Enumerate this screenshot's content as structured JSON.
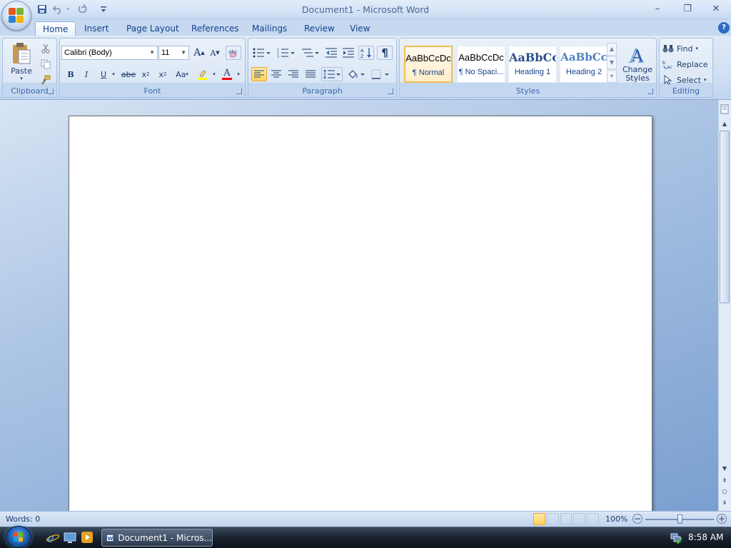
{
  "window": {
    "title": "Document1 - Microsoft Word"
  },
  "quick_access": {
    "save_icon": "save-icon",
    "undo_icon": "undo-icon",
    "redo_icon": "redo-icon",
    "customize_icon": "customize-icon"
  },
  "window_controls": {
    "minimize": "–",
    "restore": "❐",
    "close": "✕"
  },
  "tabs": [
    {
      "label": "Home"
    },
    {
      "label": "Insert"
    },
    {
      "label": "Page Layout"
    },
    {
      "label": "References"
    },
    {
      "label": "Mailings"
    },
    {
      "label": "Review"
    },
    {
      "label": "View"
    }
  ],
  "help": "?",
  "ribbon": {
    "clipboard": {
      "label": "Clipboard",
      "paste": "Paste"
    },
    "font": {
      "label": "Font",
      "family": "Calibri (Body)",
      "size": "11",
      "grow": "A",
      "shrink": "A",
      "bold": "B",
      "italic": "I",
      "underline": "U",
      "strike": "abe",
      "subscript": "x",
      "sub_mark": "2",
      "superscript": "x",
      "sup_mark": "2",
      "case": "Aa",
      "font_color": "A"
    },
    "paragraph": {
      "label": "Paragraph",
      "pilcrow": "¶"
    },
    "styles": {
      "label": "Styles",
      "items": [
        {
          "sample": "AaBbCcDc",
          "name": "¶ Normal"
        },
        {
          "sample": "AaBbCcDc",
          "name": "¶ No Spaci..."
        },
        {
          "sample": "AaBbCc",
          "name": "Heading 1"
        },
        {
          "sample": "AaBbCc",
          "name": "Heading 2"
        }
      ],
      "change_styles": "Change Styles"
    },
    "editing": {
      "label": "Editing",
      "find": "Find",
      "replace": "Replace",
      "select": "Select"
    }
  },
  "status": {
    "words": "Words: 0",
    "zoom": "100%",
    "zoom_level": 1.0
  },
  "taskbar": {
    "task": "Document1 - Micros...",
    "time": "8:58 AM"
  },
  "colors": {
    "accent": "#15428b",
    "highlight": "#ffd35a",
    "font_color_bar": "#ff0000",
    "highlight_bar": "#ffff00"
  }
}
